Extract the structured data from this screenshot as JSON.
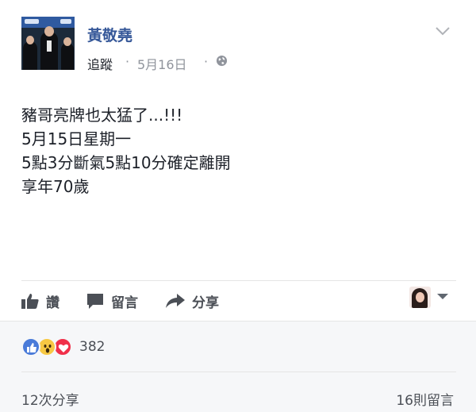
{
  "post": {
    "author": "黃敬堯",
    "follow_label": "追蹤",
    "separator": "·",
    "date": "5月16日",
    "body_lines": [
      "豬哥亮牌也太猛了...!!!",
      "5月15日星期一",
      "5點3分斷氣5點10分確定離開",
      "享年70歲"
    ]
  },
  "actions": {
    "like_label": "讚",
    "comment_label": "留言",
    "share_label": "分享"
  },
  "stats": {
    "reaction_count": "382",
    "shares_text": "12次分享",
    "comments_text": "16則留言"
  },
  "colors": {
    "author_link": "#365899",
    "meta_gray": "#90949c",
    "action_gray": "#4b4f56",
    "like_blue": "#4a7bd9",
    "wow_yellow": "#f7c843",
    "love_red": "#f0304a"
  },
  "icons": [
    "globe-icon",
    "chevron-down-icon",
    "thumbs-up-icon",
    "comment-icon",
    "share-arrow-icon",
    "caret-down-icon",
    "like-reaction-icon",
    "wow-reaction-icon",
    "love-reaction-icon"
  ]
}
